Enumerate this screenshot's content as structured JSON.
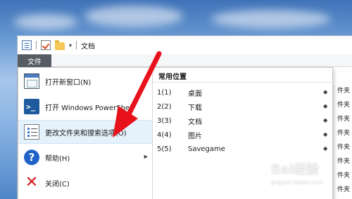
{
  "title_bar": {
    "icons": [
      "properties-icon",
      "check-icon",
      "folder-icon",
      "dropdown-caret-icon"
    ],
    "caret": "▾",
    "location": "文档"
  },
  "file_tab": "文件",
  "file_menu": {
    "items": [
      {
        "label": "打开新窗口(N)",
        "icon": "new-window-icon",
        "has_submenu": true
      },
      {
        "label": "打开 Windows PowerShell",
        "icon": "powershell-icon",
        "has_submenu": false
      },
      {
        "label": "更改文件夹和搜索选项(O)",
        "icon": "folder-options-icon",
        "has_submenu": false
      },
      {
        "label": "帮助(H)",
        "icon": "help-icon",
        "glyph": "?",
        "has_submenu": true
      },
      {
        "label": "关闭(C)",
        "icon": "close-icon",
        "glyph": "✕",
        "has_submenu": false
      }
    ],
    "submenu_arrow": "▶",
    "ps_glyph": ">_",
    "recent": {
      "heading": "常用位置",
      "items": [
        {
          "key": "1(1)",
          "name": "桌面"
        },
        {
          "key": "2(2)",
          "name": "下载"
        },
        {
          "key": "3(3)",
          "name": "文档"
        },
        {
          "key": "4(4)",
          "name": "图片"
        },
        {
          "key": "5(5)",
          "name": "Savegame"
        }
      ],
      "pin_glyph": "📌"
    }
  },
  "underlay_text": [
    "件夹",
    "件夹",
    "件夹",
    "件夹",
    "件夹",
    "件夹",
    "件夹",
    "件夹"
  ],
  "watermark": {
    "text": "Bai经验",
    "sub": "jingyan.baidu.com"
  },
  "colors": {
    "file_tab": "#555c63",
    "hover": "#e5f1fb",
    "arrow": "#e8121b",
    "help": "#1f63c8",
    "close": "#d11a1a"
  }
}
